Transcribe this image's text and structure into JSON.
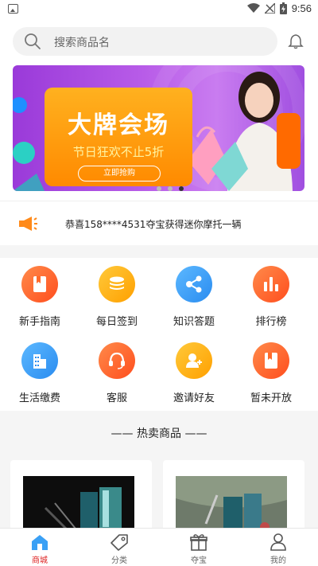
{
  "status_bar": {
    "time": "9:56"
  },
  "search": {
    "placeholder": "搜索商品名"
  },
  "banner": {
    "title": "大牌会场",
    "subtitle": "节日狂欢不止5折",
    "button": "立即抢购",
    "active_dot": 3,
    "dot_count": 3
  },
  "notice": {
    "text": "恭喜158****4531夺宝获得迷你摩托一辆"
  },
  "menu": [
    {
      "label": "新手指南",
      "icon": "book-icon",
      "color": "#ff6a2b"
    },
    {
      "label": "每日签到",
      "icon": "coins-icon",
      "color": "#ffb01a"
    },
    {
      "label": "知识答题",
      "icon": "share-icon",
      "color": "#3aa0f5"
    },
    {
      "label": "排行榜",
      "icon": "bar-chart-icon",
      "color": "#ff6a2b"
    },
    {
      "label": "生活缴费",
      "icon": "building-icon",
      "color": "#3aa0f5"
    },
    {
      "label": "客服",
      "icon": "headset-icon",
      "color": "#ff6a2b"
    },
    {
      "label": "邀请好友",
      "icon": "add-user-icon",
      "color": "#ffb01a"
    },
    {
      "label": "暂未开放",
      "icon": "book-icon",
      "color": "#ff6a2b"
    }
  ],
  "hot_section": {
    "title": "—— 热卖商品 ——"
  },
  "tabs": [
    {
      "label": "商城",
      "icon": "home-icon",
      "active": true
    },
    {
      "label": "分类",
      "icon": "tag-icon",
      "active": false
    },
    {
      "label": "夺宝",
      "icon": "gift-icon",
      "active": false
    },
    {
      "label": "我的",
      "icon": "user-icon",
      "active": false
    }
  ],
  "colors": {
    "accent": "#d22222",
    "banner_purple": "#9a3ad9",
    "promo_orange": "#ff9a00"
  }
}
